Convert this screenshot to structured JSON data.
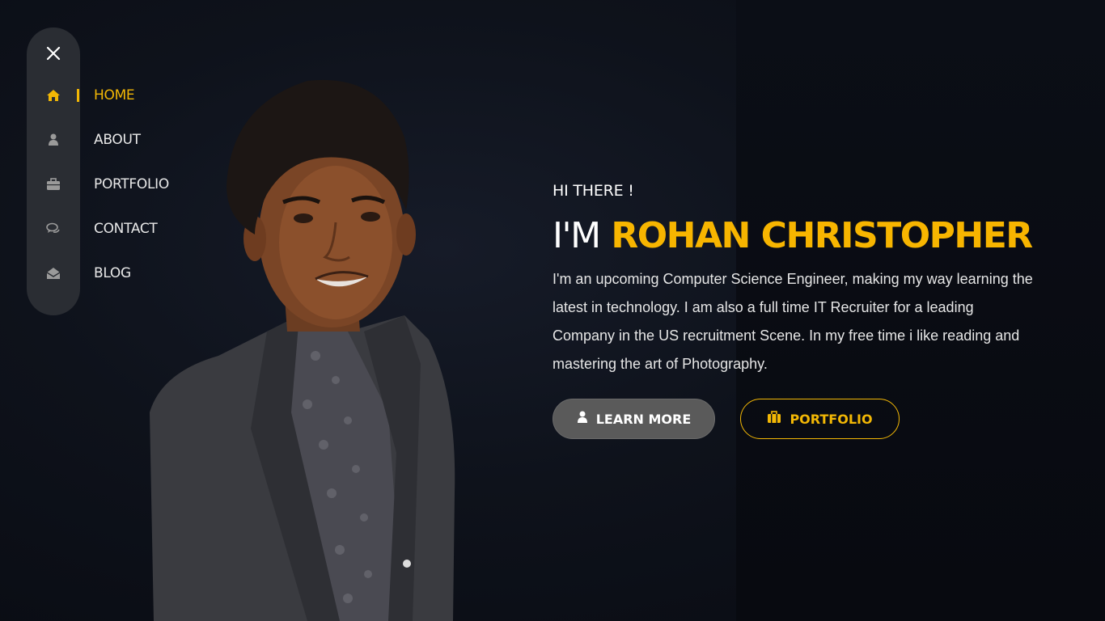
{
  "sidebar": {
    "close_icon": "close-icon",
    "items": [
      {
        "label": "HOME",
        "icon": "home-icon",
        "active": true
      },
      {
        "label": "ABOUT",
        "icon": "user-icon",
        "active": false
      },
      {
        "label": "PORTFOLIO",
        "icon": "briefcase-icon",
        "active": false
      },
      {
        "label": "CONTACT",
        "icon": "chat-icon",
        "active": false
      },
      {
        "label": "BLOG",
        "icon": "envelope-open-icon",
        "active": false
      }
    ]
  },
  "hero": {
    "greeting": "HI THERE !",
    "title_prefix": "I'M",
    "name": "ROHAN CHRISTOPHER",
    "description": "I'm an upcoming Computer Science Engineer, making my way learning the latest in technology. I am also a full time IT Recruiter for a leading Company in the US recruitment Scene. In my free time i like reading and mastering the art of Photography.",
    "learn_more_label": "LEARN MORE",
    "portfolio_label": "PORTFOLIO"
  },
  "colors": {
    "accent": "#f2b705",
    "background": "#0e121b",
    "sidebar": "#2a2d33"
  }
}
